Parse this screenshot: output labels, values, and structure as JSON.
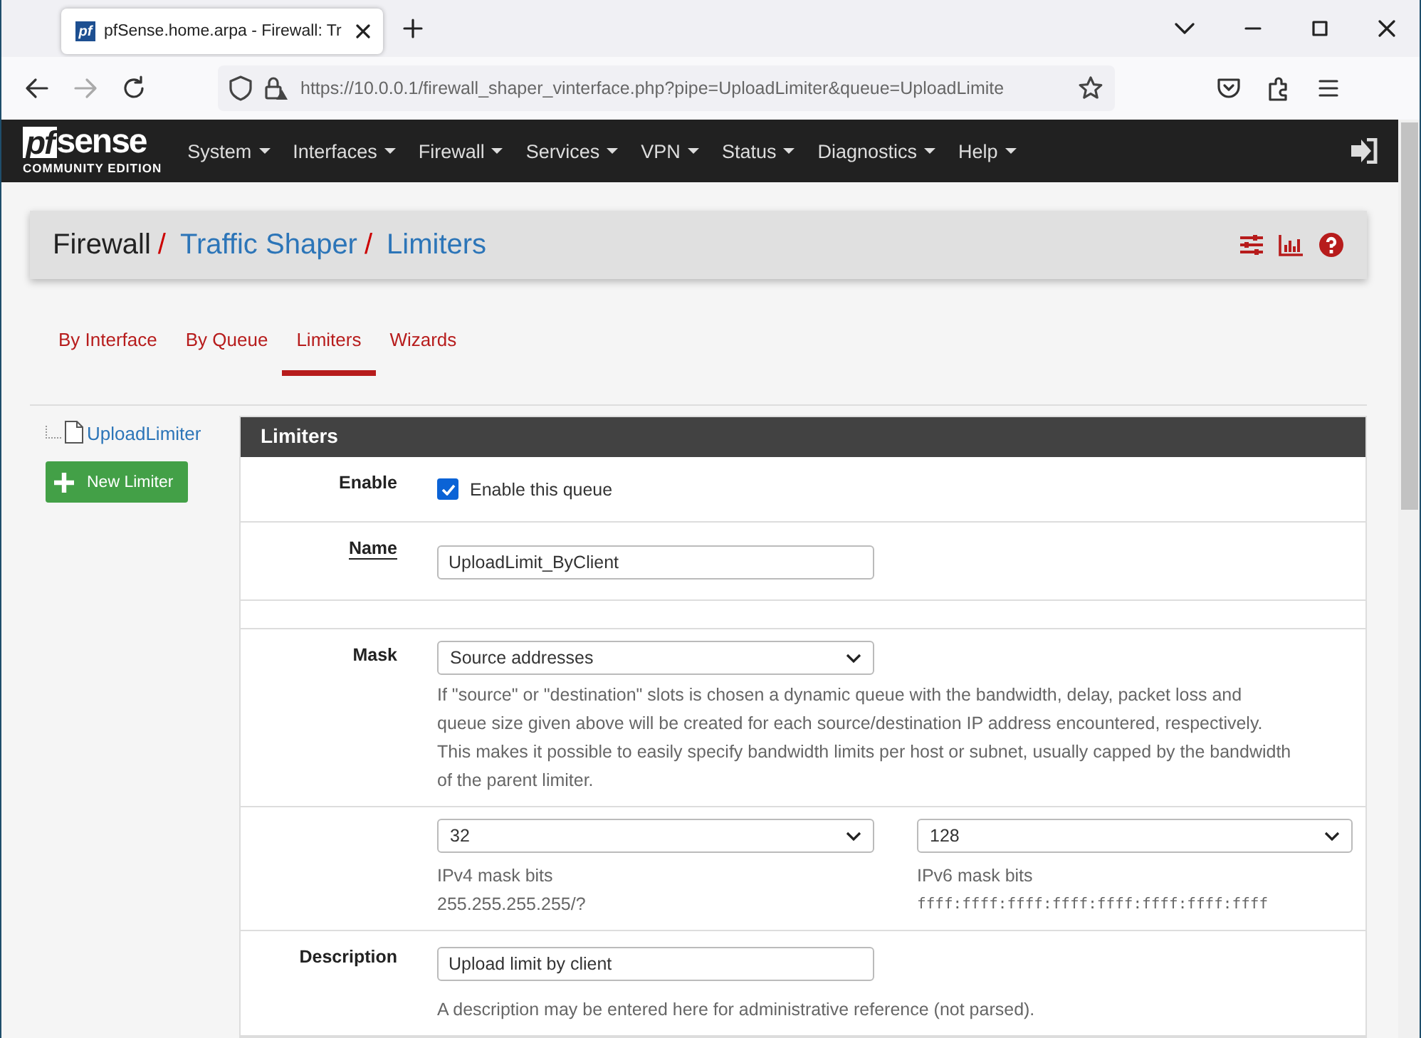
{
  "browser": {
    "tab_title": "pfSense.home.arpa - Firewall: Tr",
    "favicon": "pf",
    "url": "https://10.0.0.1/firewall_shaper_vinterface.php?pipe=UploadLimiter&queue=UploadLimite"
  },
  "nav": {
    "logo_boxed": "pf",
    "logo_text": "sense",
    "logo_subtitle": "COMMUNITY EDITION",
    "menu": [
      "System",
      "Interfaces",
      "Firewall",
      "Services",
      "VPN",
      "Status",
      "Diagnostics",
      "Help"
    ]
  },
  "breadcrumb": {
    "separator": "/",
    "items": [
      {
        "label": "Firewall",
        "kind": "plain"
      },
      {
        "label": "Traffic Shaper",
        "kind": "link"
      },
      {
        "label": "Limiters",
        "kind": "link"
      }
    ]
  },
  "tabs": [
    {
      "label": "By Interface",
      "selected": false
    },
    {
      "label": "By Queue",
      "selected": false
    },
    {
      "label": "Limiters",
      "selected": true
    },
    {
      "label": "Wizards",
      "selected": false
    }
  ],
  "tree": {
    "items": [
      {
        "label": "UploadLimiter"
      }
    ]
  },
  "new_button": "New Limiter",
  "panel": {
    "title": "Limiters",
    "rows": [
      {
        "kind": "checkbox",
        "label": "Enable",
        "text": "Enable this queue",
        "checked": true
      },
      {
        "kind": "input",
        "label": "Name",
        "value": "UploadLimit_ByClient"
      },
      {
        "kind": "blank"
      },
      {
        "kind": "select",
        "label": "Mask",
        "value": "Source addresses",
        "help": "If \"source\" or \"destination\" slots is chosen a dynamic queue with the bandwidth, delay, packet loss and queue size given above will be created for each source/destination IP address encountered, respectively. This makes it possible to easily specify bandwidth limits per host or subnet, usually capped by the bandwidth of the parent limiter."
      },
      {
        "kind": "pair",
        "selects": [
          {
            "value": "32",
            "caption": "IPv4 mask bits",
            "note": "255.255.255.255/?",
            "mono": false
          },
          {
            "value": "128",
            "caption": "IPv6 mask bits",
            "note": "ffff:ffff:ffff:ffff:ffff:ffff:ffff:ffff",
            "mono": true
          }
        ]
      },
      {
        "kind": "input",
        "label": "Description",
        "value": "Upload limit by client",
        "help": "A description may be entered here for administrative reference (not parsed)."
      }
    ]
  }
}
